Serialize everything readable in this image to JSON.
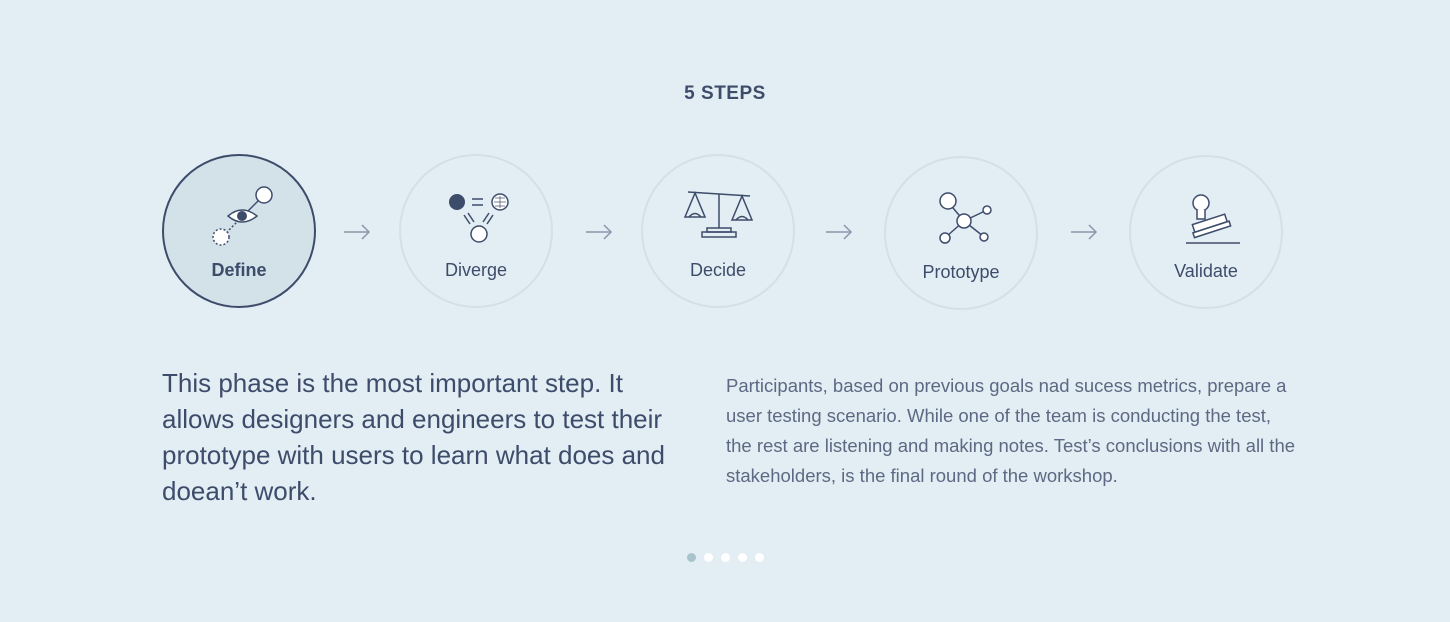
{
  "title": "5 STEPS",
  "steps": [
    {
      "label": "Define",
      "icon": "eye-target-icon",
      "active": true
    },
    {
      "label": "Diverge",
      "icon": "diverge-icon",
      "active": false
    },
    {
      "label": "Decide",
      "icon": "scales-icon",
      "active": false
    },
    {
      "label": "Prototype",
      "icon": "network-icon",
      "active": false
    },
    {
      "label": "Validate",
      "icon": "stamp-icon",
      "active": false
    }
  ],
  "lead_text": "This phase is the most important step. It allows designers and engineers to test their prototype with users to learn what does and doean’t work.",
  "description": "Participants, based on previous goals nad sucess metrics, prepare a user testing scenario. While one of the team is conducting the test, the rest are listening and making notes. Test’s conclusions with all the stakeholders, is the final round of the workshop.",
  "pagination": {
    "total": 5,
    "current": 1
  },
  "colors": {
    "background": "#e2eef3",
    "text": "#3e4c6b",
    "active_fill": "#d3e2e9",
    "ring": "#d3e0e6"
  }
}
